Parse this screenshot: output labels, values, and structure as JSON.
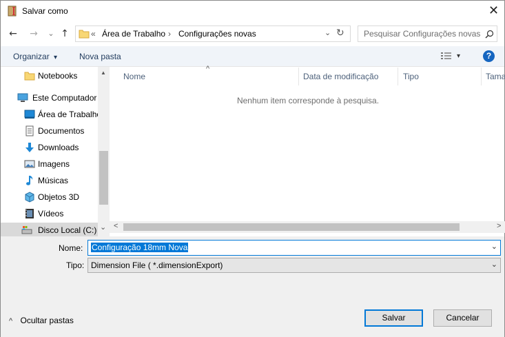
{
  "window": {
    "title": "Salvar como",
    "close_glyph": "✕"
  },
  "nav": {
    "back_glyph": "←",
    "forward_glyph": "→",
    "recent_glyph": "⌄",
    "up_glyph": "↑",
    "breadcrumb_prefix": "«",
    "breadcrumb": [
      "Área de Trabalho",
      "Configurações novas"
    ],
    "breadcrumb_sep": "›",
    "dropdown_glyph": "⌄",
    "refresh_glyph": "↻",
    "search_placeholder": "Pesquisar Configurações novas"
  },
  "toolbar": {
    "organize_label": "Organizar",
    "organize_caret": "▾",
    "new_folder_label": "Nova pasta",
    "view_caret": "▾",
    "help_glyph": "?"
  },
  "sidebar": {
    "items": [
      {
        "label": "Notebooks",
        "icon": "folder-icon"
      },
      {
        "label": "Este Computador",
        "icon": "computer-icon"
      },
      {
        "label": "Área de Trabalho",
        "icon": "desktop-icon"
      },
      {
        "label": "Documentos",
        "icon": "documents-icon"
      },
      {
        "label": "Downloads",
        "icon": "downloads-icon"
      },
      {
        "label": "Imagens",
        "icon": "pictures-icon"
      },
      {
        "label": "Músicas",
        "icon": "music-icon"
      },
      {
        "label": "Objetos 3D",
        "icon": "objects-3d-icon"
      },
      {
        "label": "Vídeos",
        "icon": "videos-icon"
      },
      {
        "label": "Disco Local (C:)",
        "icon": "disk-icon"
      }
    ],
    "scroll_up_glyph": "▲",
    "scroll_down_glyph": "⌄"
  },
  "filelist": {
    "columns": [
      "Nome",
      "Data de modificação",
      "Tipo",
      "Tama"
    ],
    "sort_glyph": "^",
    "empty_message": "Nenhum item corresponde à pesquisa.",
    "scroll_left_glyph": "<",
    "scroll_right_glyph": ">"
  },
  "form": {
    "name_label": "Nome:",
    "name_value": "Configuração 18mm Nova",
    "type_label": "Tipo:",
    "type_value": "Dimension File  ( *.dimensionExport)",
    "chevron_glyph": "⌄"
  },
  "footer": {
    "hide_folders_glyph": "^",
    "hide_folders_label": "Ocultar pastas",
    "save_label": "Salvar",
    "cancel_label": "Cancelar"
  },
  "colors": {
    "accent": "#0078d7",
    "toolbar_bg": "#f0f4f9",
    "panel_bg": "#f0f0f0",
    "help_blue": "#1565c0"
  }
}
